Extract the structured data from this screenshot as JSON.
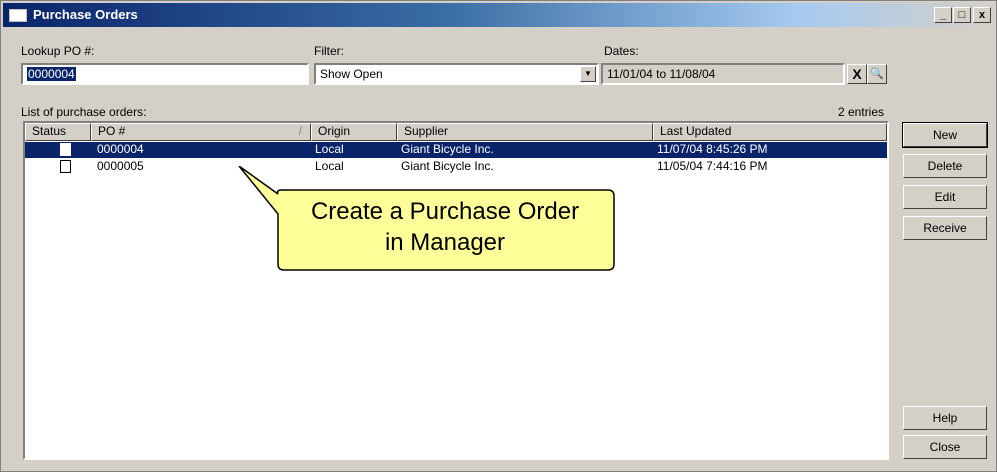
{
  "window": {
    "title": "Purchase Orders",
    "minimize": "_",
    "maximize": "□",
    "close": "x"
  },
  "lookup": {
    "label": "Lookup PO #:",
    "value": "0000004"
  },
  "filter": {
    "label": "Filter:",
    "value": "Show Open",
    "arrow": "▼"
  },
  "dates": {
    "label": "Dates:",
    "value": "11/01/04 to 11/08/04",
    "clear": "X",
    "search": "🔍"
  },
  "list": {
    "label": "List of purchase orders:",
    "count": "2 entries",
    "columns": {
      "status": "Status",
      "po": "PO #",
      "sort": "/",
      "origin": "Origin",
      "supplier": "Supplier",
      "updated": "Last Updated"
    },
    "rows": [
      {
        "po": "0000004",
        "origin": "Local",
        "supplier": "Giant Bicycle Inc.",
        "updated": "11/07/04 8:45:26 PM",
        "status_icon": "document-filled-icon"
      },
      {
        "po": "0000005",
        "origin": "Local",
        "supplier": "Giant Bicycle Inc.",
        "updated": "11/05/04 7:44:16 PM",
        "status_icon": "document-outline-icon"
      }
    ]
  },
  "buttons": {
    "new": "New",
    "delete": "Delete",
    "edit": "Edit",
    "receive": "Receive",
    "help": "Help",
    "close": "Close"
  },
  "callout": {
    "line1": "Create a Purchase Order",
    "line2": "in Manager",
    "fill": "#ffff99"
  },
  "colors": {
    "selection": "#0a246a",
    "face": "#d4d0c8"
  }
}
